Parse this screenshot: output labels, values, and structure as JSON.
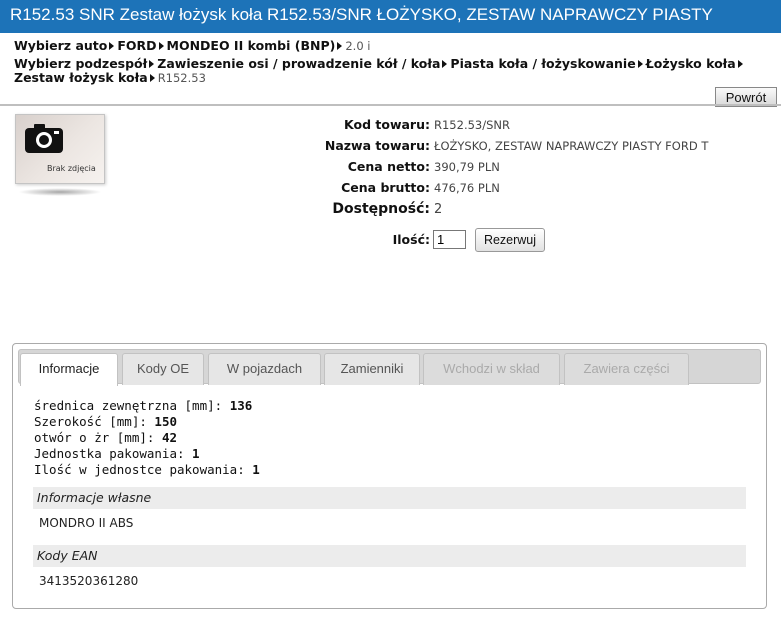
{
  "title": "R152.53 SNR Zestaw łożysk koła R152.53/SNR ŁOŻYSKO, ZESTAW NAPRAWCZY PIASTY",
  "breadcrumb": {
    "car_label": "Wybierz auto",
    "car_items": [
      "FORD",
      "MONDEO II kombi (BNP)",
      "2.0 i"
    ],
    "part_label": "Wybierz podzespół",
    "part_items": [
      "Zawieszenie osi / prowadzenie kół / koła",
      "Piasta koła / łożyskowanie",
      "Łożysko koła"
    ],
    "part_items_line2": [
      "Zestaw łożysk koła",
      "R152.53"
    ]
  },
  "back_label": "Powrót",
  "photo": {
    "label": "Brak zdjęcia",
    "icon": "camera-icon"
  },
  "details": {
    "code_label": "Kod towaru:",
    "code_value": "R152.53/SNR",
    "name_label": "Nazwa towaru:",
    "name_value": "ŁOŻYSKO, ZESTAW NAPRAWCZY PIASTY FORD T",
    "net_label": "Cena netto:",
    "net_value": "390,79 PLN",
    "gross_label": "Cena brutto:",
    "gross_value": "476,76 PLN",
    "avail_label": "Dostępność:",
    "avail_value": "2",
    "qty_label": "Ilość:",
    "qty_value": "1",
    "reserve_label": "Rezerwuj"
  },
  "tabs": [
    {
      "label": "Informacje",
      "state": "active"
    },
    {
      "label": "Kody OE",
      "state": "normal"
    },
    {
      "label": "W pojazdach",
      "state": "normal"
    },
    {
      "label": "Zamienniki",
      "state": "normal"
    },
    {
      "label": "Wchodzi w skład",
      "state": "disabled"
    },
    {
      "label": "Zawiera części",
      "state": "disabled"
    }
  ],
  "attributes": [
    {
      "name": "średnica zewnętrzna [mm]:",
      "value": "136"
    },
    {
      "name": "Szerokość [mm]:",
      "value": "150"
    },
    {
      "name": "otwór o żr [mm]:",
      "value": "42"
    },
    {
      "name": "Jednostka pakowania:",
      "value": "1"
    },
    {
      "name": "Ilość w jednostce pakowania:",
      "value": "1"
    }
  ],
  "own_info": {
    "label": "Informacje własne",
    "value": "MONDRO II ABS"
  },
  "ean": {
    "label": "Kody EAN",
    "value": "3413520361280"
  },
  "colors": {
    "titlebar": "#1d73b8"
  }
}
